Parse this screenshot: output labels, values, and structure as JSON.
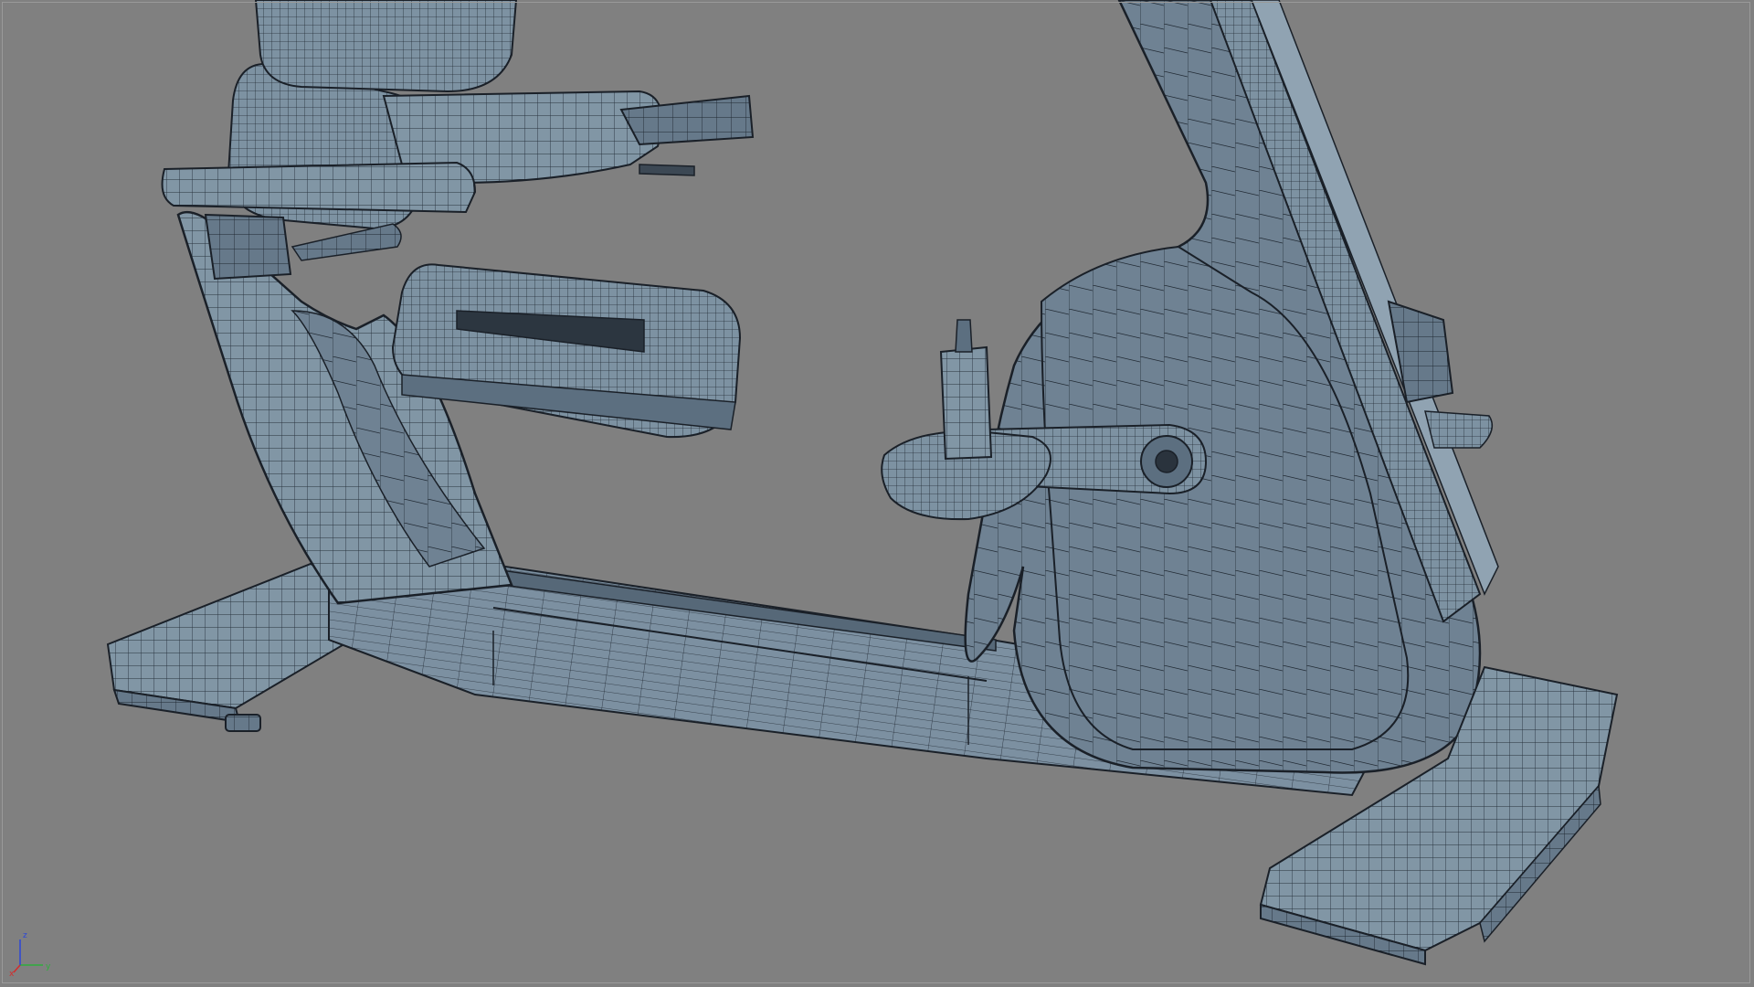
{
  "viewport": {
    "background": "#808080",
    "shading": "wireframe-on-shaded",
    "model_color": "#8196a5",
    "wire_color": "#1e2630"
  },
  "axis_indicator": {
    "x_label": "x",
    "y_label": "y",
    "z_label": "z",
    "x_color": "#d22c2c",
    "y_color": "#2eae3c",
    "z_color": "#2b46d8"
  }
}
